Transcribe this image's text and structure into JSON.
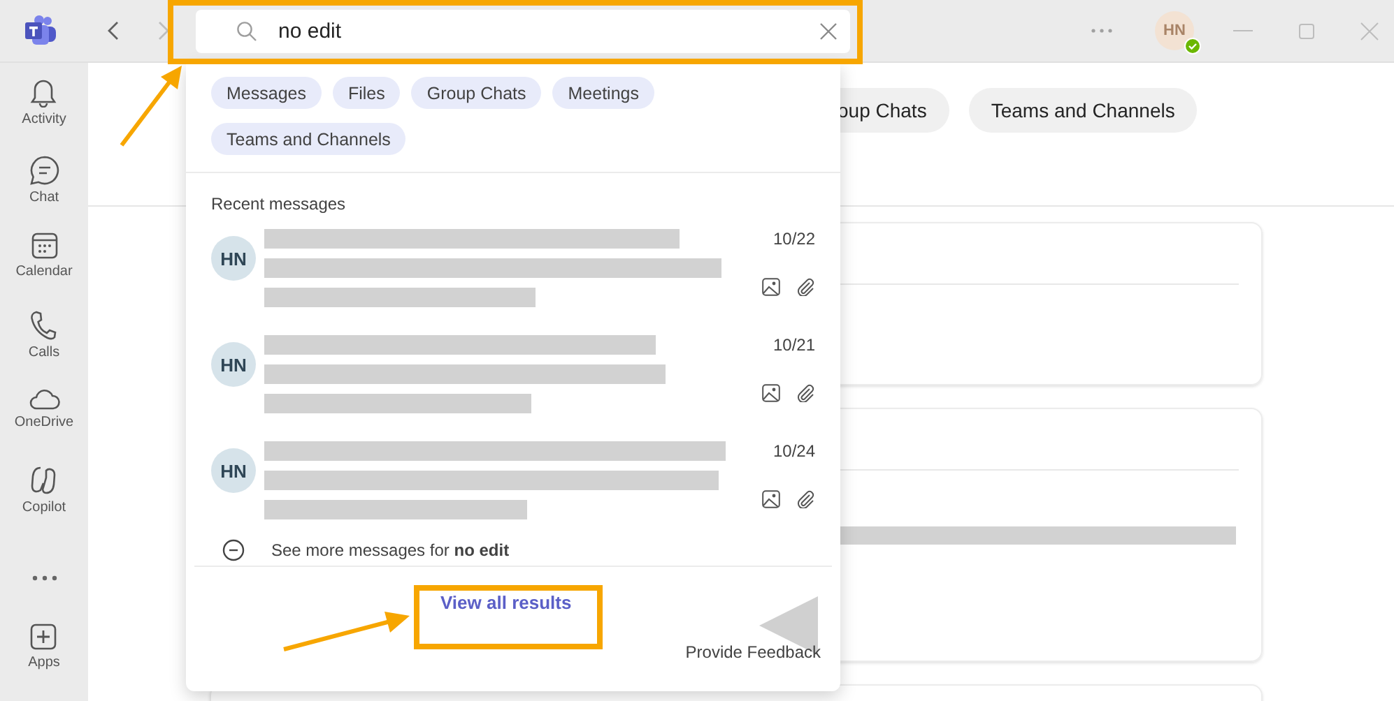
{
  "search": {
    "value": "no edit"
  },
  "rail": [
    {
      "label": "Activity"
    },
    {
      "label": "Chat"
    },
    {
      "label": "Calendar"
    },
    {
      "label": "Calls"
    },
    {
      "label": "OneDrive"
    },
    {
      "label": "Copilot"
    },
    {
      "kind": "more"
    },
    {
      "label": "Apps"
    }
  ],
  "account": {
    "initials": "HN"
  },
  "background_filters": [
    "oup Chats",
    "Teams and Channels"
  ],
  "dropdown": {
    "filters": [
      "Messages",
      "Files",
      "Group Chats",
      "Meetings",
      "Teams and Channels"
    ],
    "section_title": "Recent messages",
    "messages": [
      {
        "avatar": "HN",
        "date": "10/22",
        "has_image": true,
        "has_attachment": true
      },
      {
        "avatar": "HN",
        "date": "10/21",
        "has_image": true,
        "has_attachment": true
      },
      {
        "avatar": "HN",
        "date": "10/24",
        "has_image": true,
        "has_attachment": true
      }
    ],
    "see_more": "See more messages for **no edit**",
    "view_all": "View all results",
    "feedback": "Provide Feedback"
  }
}
